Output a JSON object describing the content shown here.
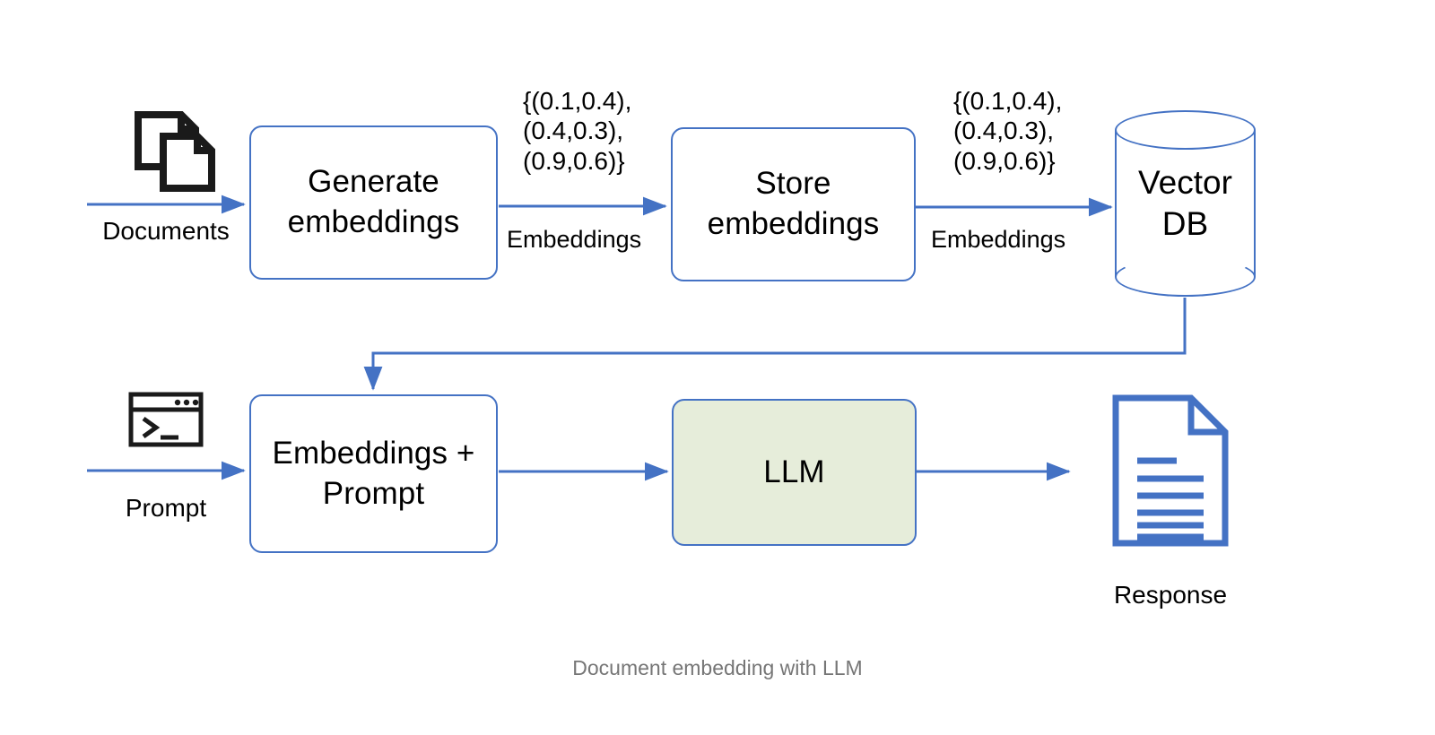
{
  "figure": {
    "caption": "Document embedding with LLM",
    "accent_color": "#4472c4",
    "box_fill": "#ffffff",
    "llm_fill": "#e6edda",
    "text_color": "#000000",
    "caption_color": "#767676",
    "icon_black": "#1a1a1a",
    "icon_blue": "#4472c4"
  },
  "top_row": {
    "source": {
      "icon": "documents-icon",
      "caption": "Documents"
    },
    "generate_box": {
      "label": "Generate\nembeddings"
    },
    "edge_1": {
      "vector_text": "{(0.1,0.4),\n(0.4,0.3),\n(0.9,0.6)}",
      "flow_label": "Embeddings"
    },
    "store_box": {
      "label": "Store\nembeddings"
    },
    "edge_2": {
      "vector_text": "{(0.1,0.4),\n(0.4,0.3),\n(0.9,0.6)}",
      "flow_label": "Embeddings"
    },
    "vector_db": {
      "label": "Vector\nDB"
    }
  },
  "bottom_row": {
    "source": {
      "icon": "terminal-icon",
      "caption": "Prompt"
    },
    "combine_box": {
      "label": "Embeddings +\nPrompt"
    },
    "llm_box": {
      "label": "LLM"
    },
    "response": {
      "icon": "document-response-icon",
      "caption": "Response"
    }
  }
}
